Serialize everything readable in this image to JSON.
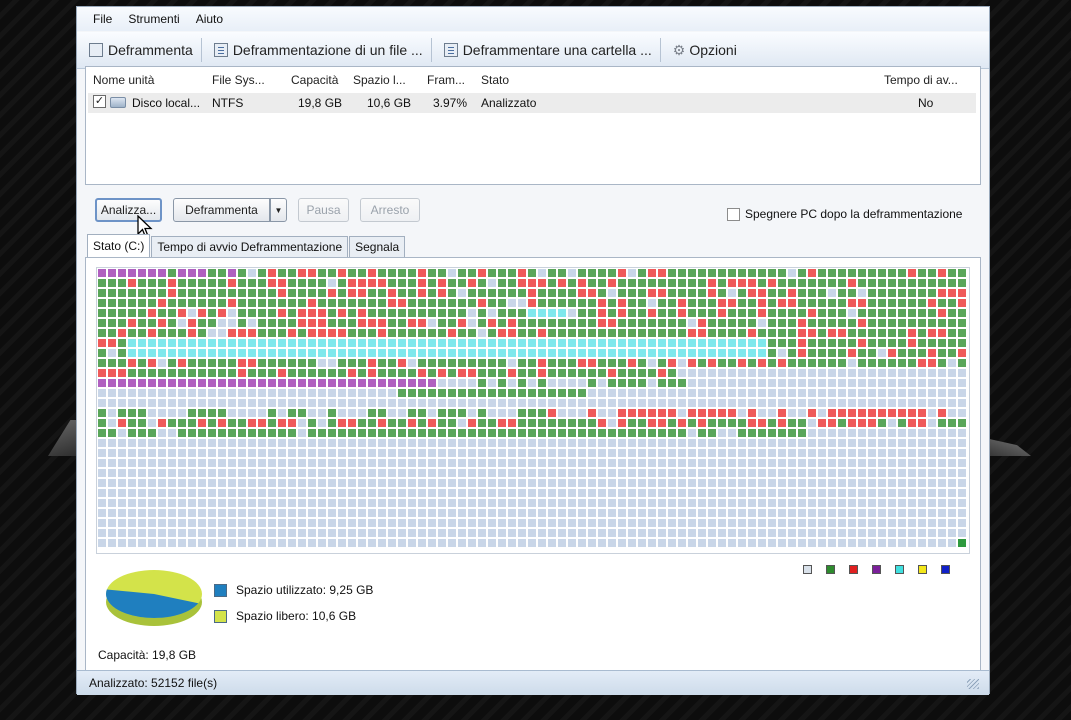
{
  "menu": [
    "File",
    "Strumenti",
    "Aiuto"
  ],
  "toolbar": {
    "defrag": "Deframmenta",
    "defrag_file": "Deframmentazione di un file ...",
    "defrag_folder": "Deframmentare una cartella ...",
    "options": "Opzioni"
  },
  "drive_list": {
    "columns": [
      "Nome unità",
      "File Sys...",
      "Capacità",
      "Spazio l...",
      "Fram...",
      "Stato",
      "Tempo di av..."
    ],
    "rows": [
      {
        "checked": true,
        "name": "Disco local...",
        "fs": "NTFS",
        "capacity": "19,8 GB",
        "free": "10,6 GB",
        "frag": "3.97%",
        "status": "Analizzato",
        "boot_time": "No"
      }
    ]
  },
  "actions": {
    "analyze": "Analizza...",
    "defrag": "Deframmenta",
    "pause": "Pausa",
    "stop": "Arresto",
    "shutdown_label": "Spegnere PC dopo la deframmentazione",
    "shutdown_checked": false
  },
  "tabs": [
    "Stato (C:)",
    "Tempo di avvio Deframmentazione",
    "Segnala"
  ],
  "legend_colors": [
    "#d9e1ea",
    "#2e8b2e",
    "#e02020",
    "#7b1f9a",
    "#40e0e0",
    "#f3e71a",
    "#1020c8"
  ],
  "cluster_colors": {
    "free": "#c9d6e8",
    "used": "#5aa65a",
    "fragmented": "#ef5a5a",
    "mft": "#b060c0",
    "system": "#7fe8ec",
    "ok": "#2e9a3e"
  },
  "disk": {
    "used_label": "Spazio utilizzato: 9,25 GB",
    "free_label": "Spazio libero: 10,6 GB",
    "capacity_label": "Capacità: 19,8 GB",
    "used_color": "#1f7fbf",
    "free_color": "#d3e34a",
    "used_fraction": 0.467
  },
  "status": "Analizzato: 52152 file(s)"
}
